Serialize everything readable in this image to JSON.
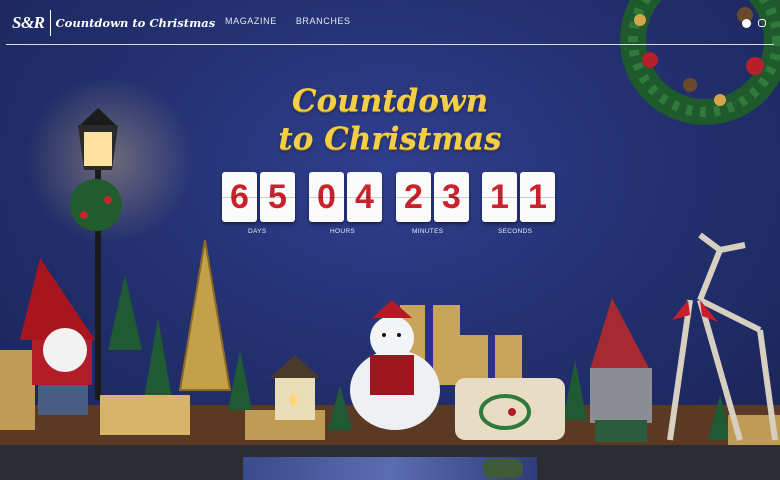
{
  "header": {
    "logo_text": "S&R",
    "site_title": "Countdown to Christmas",
    "nav": [
      "MAGAZINE",
      "BRANCHES"
    ],
    "social_icons": [
      "facebook-icon",
      "instagram-icon"
    ]
  },
  "hero": {
    "title_line1": "Countdown",
    "title_line2": "to Christmas",
    "countdown": {
      "days": {
        "d1": "6",
        "d2": "5",
        "label": "DAYS"
      },
      "hours": {
        "d1": "0",
        "d2": "4",
        "label": "HOURS"
      },
      "minutes": {
        "d1": "2",
        "d2": "3",
        "label": "MINUTES"
      },
      "seconds": {
        "d1": "1",
        "d2": "1",
        "label": "SECONDS"
      }
    }
  },
  "colors": {
    "background": "#243272",
    "title_gold": "#f2cf46",
    "digit_red": "#c8232c",
    "footer": "#2b2d33"
  }
}
